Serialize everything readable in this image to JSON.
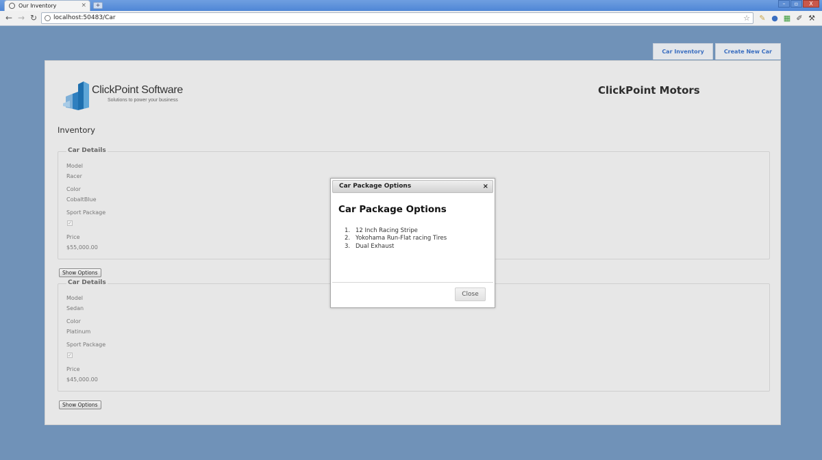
{
  "browser": {
    "tab_title": "Our Inventory",
    "tab_close": "×",
    "new_tab": "+",
    "address": "localhost:50483/Car",
    "window_buttons": [
      "–",
      "▫",
      "X"
    ]
  },
  "nav": {
    "items": [
      "Car Inventory",
      "Create New Car"
    ]
  },
  "header": {
    "logo_name": "ClickPoint Software",
    "logo_tagline": "Solutions to power your business",
    "brand": "ClickPoint Motors"
  },
  "main": {
    "heading": "Inventory",
    "cars": [
      {
        "legend": "Car Details",
        "model_label": "Model",
        "model": "Racer",
        "color_label": "Color",
        "color": "CobaltBlue",
        "sport_label": "Sport Package",
        "sport_checked": true,
        "price_label": "Price",
        "price": "$55,000.00",
        "button": "Show Options"
      },
      {
        "legend": "Car Details",
        "model_label": "Model",
        "model": "Sedan",
        "color_label": "Color",
        "color": "Platinum",
        "sport_label": "Sport Package",
        "sport_checked": true,
        "price_label": "Price",
        "price": "$45,000.00",
        "button": "Show Options"
      }
    ]
  },
  "dialog": {
    "title": "Car Package Options",
    "close_x": "×",
    "heading": "Car Package Options",
    "items": [
      {
        "num": "1.",
        "text": "12 Inch Racing Stripe"
      },
      {
        "num": "2.",
        "text": "Yokohama Run-Flat racing Tires"
      },
      {
        "num": "3.",
        "text": "Dual Exhaust"
      }
    ],
    "close_label": "Close"
  },
  "colors": {
    "background": "#7092b8",
    "panel": "#e7e7e7",
    "link": "#3a6ec0"
  }
}
